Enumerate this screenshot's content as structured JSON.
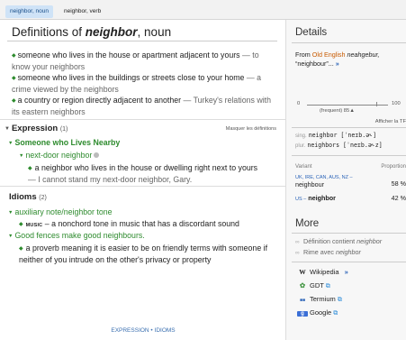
{
  "tabs": [
    {
      "label": "neighbor, noun"
    },
    {
      "label": "neighbor, verb"
    }
  ],
  "main": {
    "title_prefix": "Definitions of ",
    "title_word": "neighbor",
    "title_pos": ", noun",
    "definitions": [
      {
        "text": "someone who lives in the house or apartment adjacent to yours",
        "example": " — to know your neighbors"
      },
      {
        "text": "someone who lives in the buildings or streets close to your home",
        "example": " — a crime viewed by the neighbors"
      },
      {
        "text": "a country or region directly adjacent to another",
        "example": " — Turkey's relations with its eastern neighbors"
      }
    ],
    "expression": {
      "header": "Expression",
      "count": "(1)",
      "hide_link": "Masquer les définitions",
      "phrase": "Someone who Lives Nearby",
      "sub_term": "next-door neighbor",
      "sub_def": "a neighbor who lives in the house or dwelling right next to yours",
      "sub_example": " — I cannot stand my next-door neighbor, Gary."
    },
    "idioms": {
      "header": "Idioms",
      "count": "(2)",
      "items": [
        {
          "term": "auxiliary note/neighbor tone",
          "domain": "MUSIC",
          "def": " – a nonchord tone in music that has a discordant sound"
        },
        {
          "term": "Good fences make good neighbours.",
          "def": "a proverb meaning it is easier to be on friendly terms with someone if neither of you intrude on the other's privacy or property"
        }
      ]
    },
    "footer": "EXPRESSION • IDIOMS"
  },
  "side": {
    "details_title": "Details",
    "from_prefix": "From ",
    "from_lang": "Old English",
    "from_word": " neahgebur,",
    "from_line2": "“neighbour”...",
    "more_arrow": "»",
    "freq_min": "0",
    "freq_max": "100",
    "freq_label": "(frequent)",
    "freq_value": "85",
    "freq_fraction": 0.85,
    "afficher": "Afficher la TF",
    "sing_label": "sing.",
    "sing_value": "neighbor [ˈneɪb.ə˞]",
    "plur_label": "plur.",
    "plur_value": "neighbors [ˈneɪb.ə˞z]",
    "variant_label": "Variant",
    "proportion_label": "Proportion",
    "variants": [
      {
        "regions": "UK, IRE, CAN, AUS, NZ –",
        "word": "neighbour",
        "pct": "58 %"
      },
      {
        "regions": "US –",
        "word": "neighbor",
        "pct": "42 %"
      }
    ],
    "more_title": "More",
    "more_items": [
      {
        "label": "Définition contient ",
        "term": "neighbor"
      },
      {
        "label": "Rime avec ",
        "term": "neighbor"
      }
    ],
    "links": [
      {
        "label": "Wikipedia",
        "suffix": "»"
      },
      {
        "label": "GDT"
      },
      {
        "label": "Termium"
      },
      {
        "label": "Google"
      }
    ],
    "colors": {
      "accent": "#2e8b2e",
      "link": "#2a63b8",
      "etym": "#c85a00"
    }
  }
}
